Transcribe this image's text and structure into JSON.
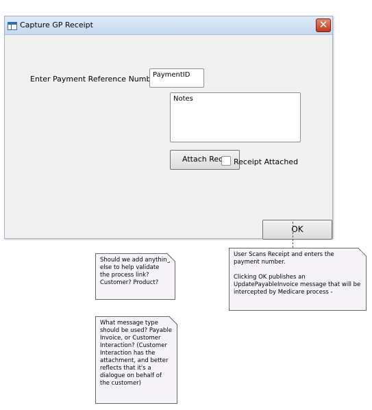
{
  "window": {
    "title": "Capture GP Receipt",
    "close_label": "✕"
  },
  "form": {
    "payment_ref_label": "Enter Payment Reference Number",
    "payment_id_value": "PaymentID",
    "notes_value": "Notes",
    "attach_button_label": "Attach Rece",
    "receipt_attached_label": "Receipt Attached",
    "receipt_attached_checked": false,
    "ok_button_label": "OK"
  },
  "notes": {
    "note_1": "Should we add anything else to help validate the process link?  Customer? Product?",
    "note_2": "What message type should be used? Payable Invoice, or Customer Interaction? (Customer Interaction has the attachment, and better reflects that it's a dialogue on behalf of the customer)",
    "note_3": "User Scans Receipt and enters the payment number.\n\nClicking OK publishes an UpdatePayableInvoice message that will be intercepted by Medicare process -"
  },
  "icons": {
    "window_icon": "form-window-icon",
    "close_icon": "close-icon"
  }
}
